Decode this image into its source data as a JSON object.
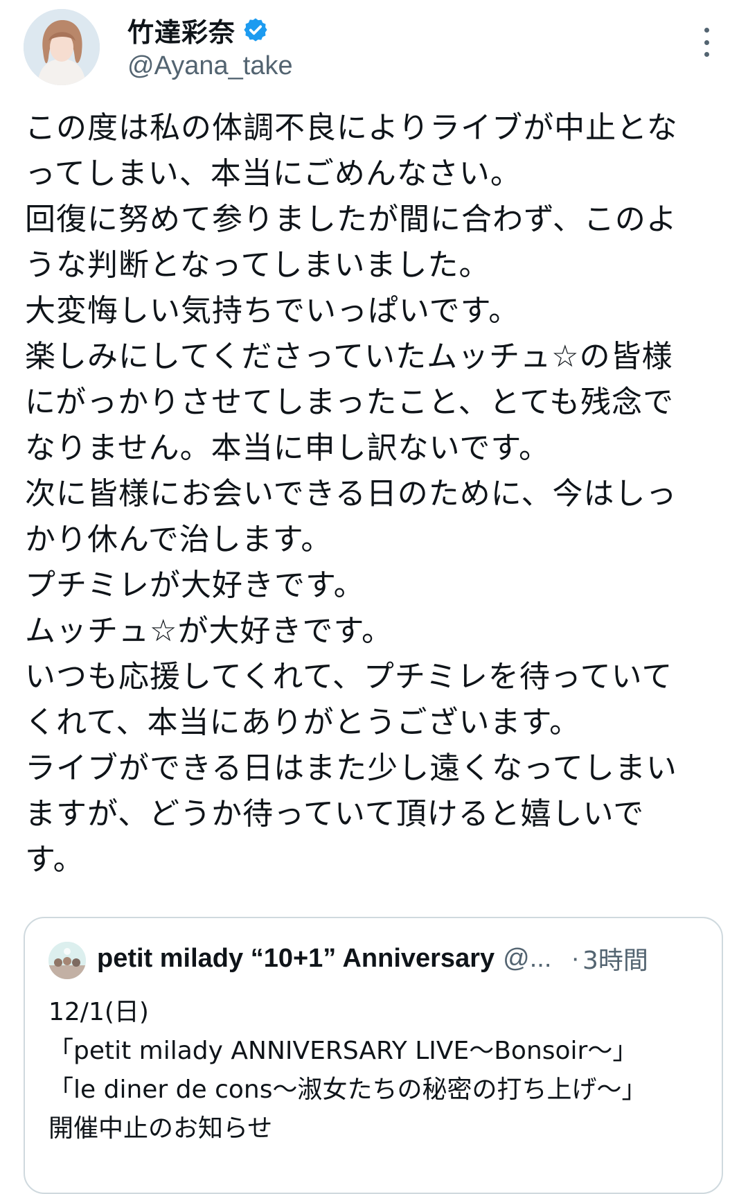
{
  "author": {
    "display_name": "竹達彩奈",
    "handle": "@Ayana_take",
    "verified": true,
    "verified_color": "#1d9bf0"
  },
  "tweet": {
    "lines": [
      "この度は私の体調不良によりライブが中止とな",
      "ってしまい、本当にごめんなさい。",
      "回復に努めて参りましたが間に合わず、このよ",
      "うな判断となってしまいました。",
      "大変悔しい気持ちでいっぱいです。",
      "楽しみにしてくださっていたムッチュ☆の皆様",
      "にがっかりさせてしまったこと、とても残念で",
      "なりません。本当に申し訳ないです。",
      "次に皆様にお会いできる日のために、今はしっ",
      "かり休んで治します。",
      "プチミレが大好きです。",
      "ムッチュ☆が大好きです。",
      "いつも応援してくれて、プチミレを待っていて",
      "くれて、本当にありがとうございます。",
      "ライブができる日はまた少し遠くなってしまい",
      "ますが、どうか待っていて頂けると嬉しいで",
      "す。"
    ]
  },
  "quoted_tweet": {
    "display_name": "petit milady “10+1” Anniversary",
    "handle": "@...",
    "dot": "·",
    "time": "3時間",
    "lines": [
      "12/1(日)",
      "「petit milady ANNIVERSARY LIVE～Bonsoir～」",
      "「le diner de cons～淑女たちの秘密の打ち上げ～」",
      "開催中止のお知らせ"
    ]
  },
  "icons": {
    "more": "more-vertical-icon",
    "verified": "verified-badge-icon"
  },
  "colors": {
    "text_primary": "#0f1419",
    "text_secondary": "#536471",
    "border": "#cfd9de"
  }
}
